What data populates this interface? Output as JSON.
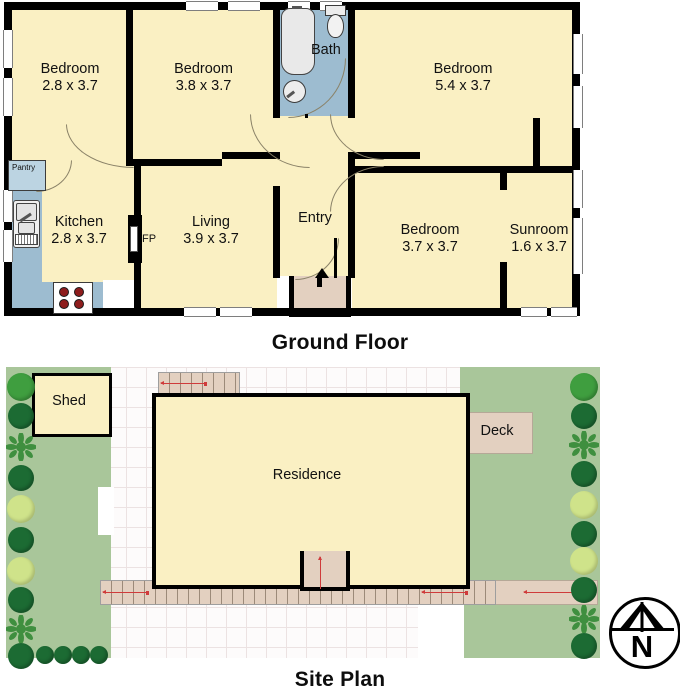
{
  "sections": {
    "ground_floor_title": "Ground Floor",
    "site_plan_title": "Site Plan"
  },
  "ground_floor": {
    "rooms": [
      {
        "name": "Bedroom",
        "dims": "2.8 x 3.7"
      },
      {
        "name": "Bedroom",
        "dims": "3.8 x 3.7"
      },
      {
        "name": "Bath",
        "dims": ""
      },
      {
        "name": "Bedroom",
        "dims": "5.4 x 3.7"
      },
      {
        "name": "Kitchen",
        "dims": "2.8 x 3.7"
      },
      {
        "name": "Living",
        "dims": "3.9 x 3.7"
      },
      {
        "name": "Entry",
        "dims": ""
      },
      {
        "name": "Bedroom",
        "dims": "3.7 x 3.7"
      },
      {
        "name": "Sunroom",
        "dims": "1.6 x 3.7"
      }
    ],
    "annotations": {
      "pantry": "Pantry",
      "fireplace": "FP"
    }
  },
  "site_plan": {
    "labels": {
      "shed": "Shed",
      "residence": "Residence",
      "deck": "Deck"
    },
    "compass": "N"
  },
  "colors": {
    "room_fill": "#faf0c3",
    "wet_fill": "#9dbcd0",
    "wall": "#000000",
    "porch_fill": "#e3d0c0",
    "grass": "#a9c69a",
    "paving": "#fdfbfb",
    "dim_arrow": "#cf3b3b"
  }
}
